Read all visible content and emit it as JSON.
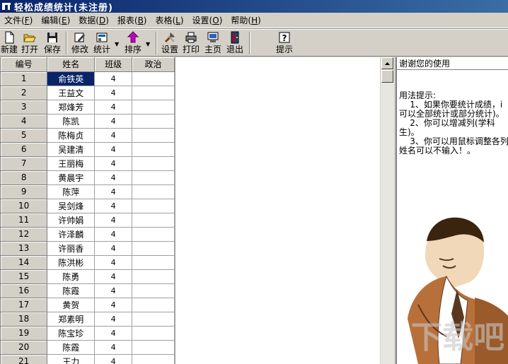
{
  "window": {
    "title": "轻松成绩统计(未注册)"
  },
  "menu": [
    {
      "label": "文件(",
      "key": "F",
      "tail": ")"
    },
    {
      "label": "编辑(",
      "key": "E",
      "tail": ")"
    },
    {
      "label": "数据(",
      "key": "D",
      "tail": ")"
    },
    {
      "label": "报表(",
      "key": "B",
      "tail": ")"
    },
    {
      "label": "表格(",
      "key": "L",
      "tail": ")"
    },
    {
      "label": "设置(",
      "key": "O",
      "tail": ")"
    },
    {
      "label": "帮助(",
      "key": "H",
      "tail": ")"
    }
  ],
  "toolbar": {
    "new": "新建",
    "open": "打开",
    "save": "保存",
    "edit": "修改",
    "stats": "统计",
    "sort": "排序",
    "settings": "设置",
    "print": "打印",
    "home": "主页",
    "exit": "退出",
    "tip": "提示"
  },
  "grid": {
    "headers": [
      "编号",
      "姓名",
      "班级",
      "政治"
    ],
    "rows": [
      [
        "1",
        "俞铁英",
        "4",
        ""
      ],
      [
        "2",
        "王益文",
        "4",
        ""
      ],
      [
        "3",
        "郑烽芳",
        "4",
        ""
      ],
      [
        "4",
        "陈凯",
        "4",
        ""
      ],
      [
        "5",
        "陈梅贞",
        "4",
        ""
      ],
      [
        "6",
        "吴建清",
        "4",
        ""
      ],
      [
        "7",
        "王丽梅",
        "4",
        ""
      ],
      [
        "8",
        "黄晨宇",
        "4",
        ""
      ],
      [
        "9",
        "陈萍",
        "4",
        ""
      ],
      [
        "10",
        "吴剑烽",
        "4",
        ""
      ],
      [
        "11",
        "许帅娟",
        "4",
        ""
      ],
      [
        "12",
        "许泽麟",
        "4",
        ""
      ],
      [
        "13",
        "许丽香",
        "4",
        ""
      ],
      [
        "14",
        "陈洪彬",
        "4",
        ""
      ],
      [
        "15",
        "陈勇",
        "4",
        ""
      ],
      [
        "16",
        "陈霞",
        "4",
        ""
      ],
      [
        "17",
        "黄贺",
        "4",
        ""
      ],
      [
        "18",
        "郑素明",
        "4",
        ""
      ],
      [
        "19",
        "陈宝珍",
        "4",
        ""
      ],
      [
        "20",
        "陈霞",
        "4",
        ""
      ],
      [
        "21",
        "王力",
        "4",
        ""
      ]
    ]
  },
  "help": {
    "header": "谢谢您的使用",
    "body_lines": [
      "用法提示:",
      "    1、如果你要统计成绩，i",
      "可以全部统计或部分统计)。",
      "    2、你可以增减列(学科",
      "生)。",
      "    3、你可以用鼠标调整各列",
      "姓名可以不输入！。"
    ]
  },
  "watermark": "下载吧",
  "colors": {
    "titlebar": "#0a246a",
    "selection": "#0a246a",
    "chrome": "#d4d0c8"
  }
}
